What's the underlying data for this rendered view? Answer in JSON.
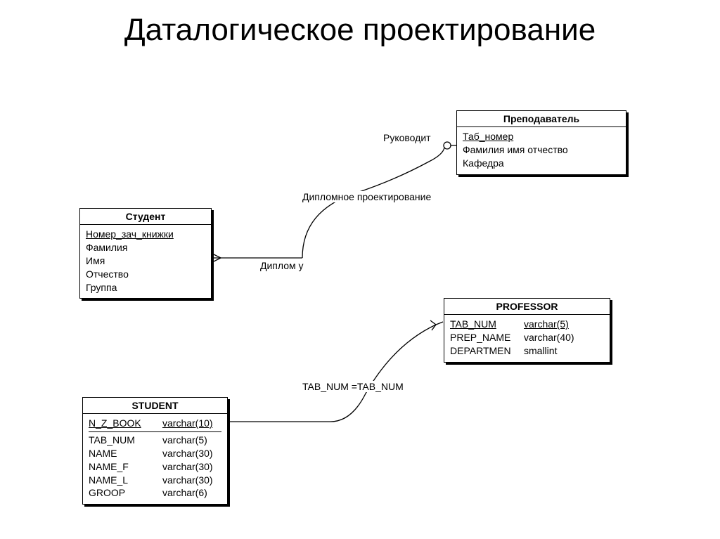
{
  "title": "Даталогическое проектирование",
  "entities": {
    "teacher": {
      "name": "Преподаватель",
      "attrs": [
        {
          "text": "Таб_номер",
          "key": true
        },
        {
          "text": "Фамилия имя отчество"
        },
        {
          "text": "Кафедра"
        }
      ]
    },
    "student": {
      "name": "Студент",
      "attrs": [
        {
          "text": "Номер_зач_книжки",
          "key": true
        },
        {
          "text": "Фамилия"
        },
        {
          "text": "Имя"
        },
        {
          "text": "Отчество"
        },
        {
          "text": "Группа"
        }
      ]
    },
    "professor": {
      "name": "PROFESSOR",
      "cols": [
        {
          "name": "TAB_NUM",
          "type": "varchar(5)",
          "key": true
        },
        {
          "name": "PREP_NAME",
          "type": "varchar(40)"
        },
        {
          "name": "DEPARTMEN",
          "type": "smallint"
        }
      ]
    },
    "student_tbl": {
      "name": "STUDENT",
      "cols": [
        {
          "name": "N_Z_BOOK",
          "type": "varchar(10)",
          "key": true
        },
        {
          "name": "TAB_NUM",
          "type": "varchar(5)"
        },
        {
          "name": "NAME",
          "type": "varchar(30)"
        },
        {
          "name": "NAME_F",
          "type": "varchar(30)"
        },
        {
          "name": "NAME_L",
          "type": "varchar(30)"
        },
        {
          "name": "GROOP",
          "type": "varchar(6)"
        }
      ]
    }
  },
  "labels": {
    "leads": "Руководит",
    "diploma_design": "Дипломное проектирование",
    "diploma_of": "Диплом у",
    "join": "TAB_NUM =TAB_NUM"
  }
}
